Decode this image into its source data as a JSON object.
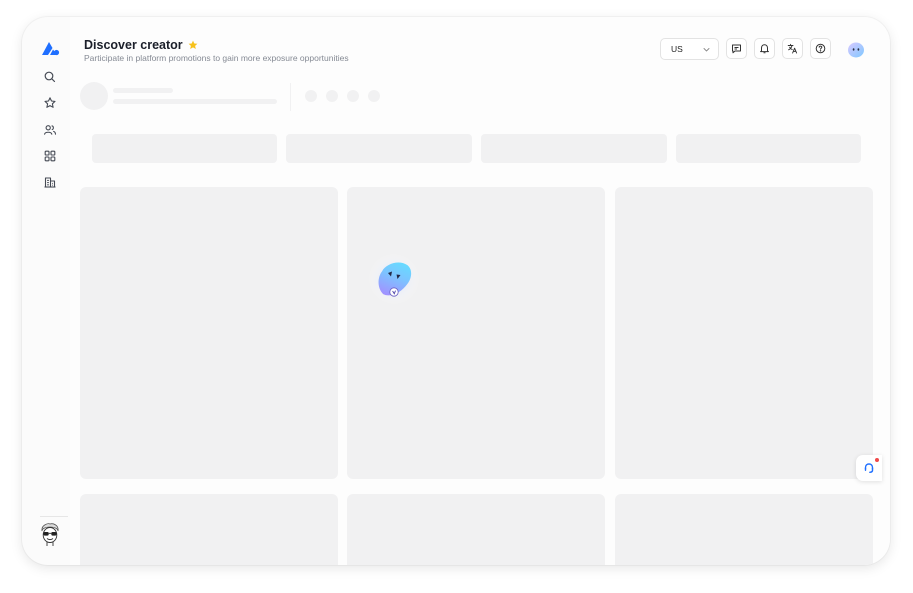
{
  "header": {
    "title": "Discover creator",
    "subtitle": "Participate in platform promotions to gain more exposure opportunities",
    "region_select_value": "US"
  },
  "colors": {
    "brand": "#1f6fff",
    "star": "#f7c21b",
    "skeleton": "#f1f1f2",
    "notification_dot": "#f04a4a"
  },
  "icons": {
    "sidebar": [
      "search-icon",
      "star-icon",
      "users-icon",
      "grid-icon",
      "building-icon"
    ],
    "header": [
      "message-icon",
      "bell-icon",
      "translate-icon",
      "help-icon"
    ]
  },
  "state": {
    "loading": true
  }
}
